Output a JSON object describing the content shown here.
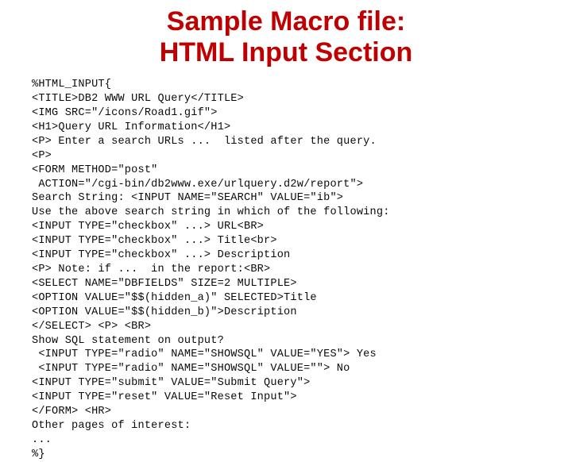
{
  "title_line1": "Sample Macro file:",
  "title_line2": "HTML Input Section",
  "code": "%HTML_INPUT{\n<TITLE>DB2 WWW URL Query</TITLE>\n<IMG SRC=\"/icons/Road1.gif\">\n<H1>Query URL Information</H1>\n<P> Enter a search URLs ...  listed after the query.\n<P>\n<FORM METHOD=\"post\"\n ACTION=\"/cgi-bin/db2www.exe/urlquery.d2w/report\">\nSearch String: <INPUT NAME=\"SEARCH\" VALUE=\"ib\">\nUse the above search string in which of the following:\n<INPUT TYPE=\"checkbox\" ...> URL<BR>\n<INPUT TYPE=\"checkbox\" ...> Title<br>\n<INPUT TYPE=\"checkbox\" ...> Description\n<P> Note: if ...  in the report:<BR>\n<SELECT NAME=\"DBFIELDS\" SIZE=2 MULTIPLE>\n<OPTION VALUE=\"$$(hidden_a)\" SELECTED>Title\n<OPTION VALUE=\"$$(hidden_b)\">Description\n</SELECT> <P> <BR>\nShow SQL statement on output?\n <INPUT TYPE=\"radio\" NAME=\"SHOWSQL\" VALUE=\"YES\"> Yes\n <INPUT TYPE=\"radio\" NAME=\"SHOWSQL\" VALUE=\"\"> No\n<INPUT TYPE=\"submit\" VALUE=\"Submit Query\">\n<INPUT TYPE=\"reset\" VALUE=\"Reset Input\">\n</FORM> <HR>\nOther pages of interest:\n...\n%}"
}
